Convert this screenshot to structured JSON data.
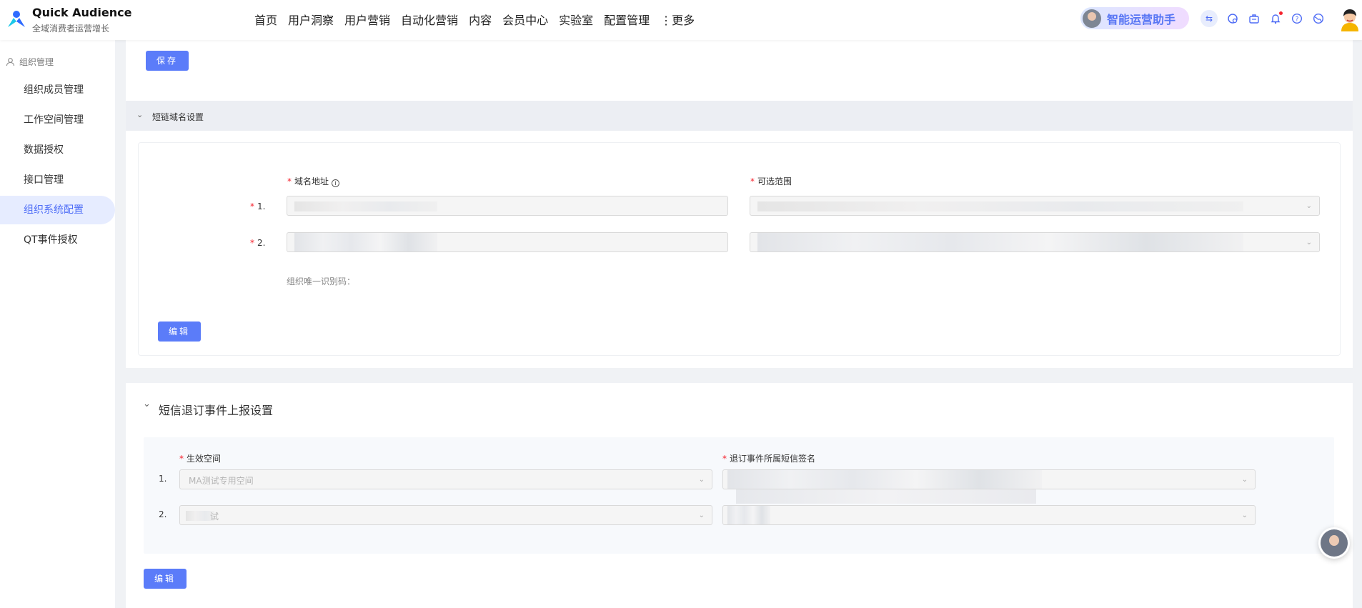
{
  "brand": {
    "name": "Quick Audience",
    "subtitle": "全域消费者运营增长"
  },
  "nav": [
    "首页",
    "用户洞察",
    "用户营销",
    "自动化营销",
    "内容",
    "会员中心",
    "实验室",
    "配置管理",
    "⋮更多"
  ],
  "assistant": {
    "label": "智能运营助手"
  },
  "sidebar": {
    "group": "组织管理",
    "items": [
      {
        "label": "组织成员管理",
        "active": false
      },
      {
        "label": "工作空间管理",
        "active": false
      },
      {
        "label": "数据授权",
        "active": false
      },
      {
        "label": "接口管理",
        "active": false
      },
      {
        "label": "组织系统配置",
        "active": true
      },
      {
        "label": "QT事件授权",
        "active": false
      }
    ]
  },
  "top_panel": {
    "save_label": "保存"
  },
  "shortlink": {
    "title": "短链域名设置",
    "domain_label": "域名地址",
    "range_label": "可选范围",
    "rows": [
      "1.",
      "2."
    ],
    "org_id_label": "组织唯一识别码：",
    "edit_label": "编辑"
  },
  "unsubscribe": {
    "title": "短信退订事件上报设置",
    "space_label": "生效空间",
    "sign_label": "退订事件所属短信签名",
    "rows": [
      {
        "num": "1.",
        "space": "MA测试专用空间"
      },
      {
        "num": "2.",
        "space": "试"
      }
    ],
    "edit_label": "编辑"
  },
  "colors": {
    "accent": "#5b7cf9",
    "required": "#f5222d",
    "active_bg": "#e6ecff"
  }
}
